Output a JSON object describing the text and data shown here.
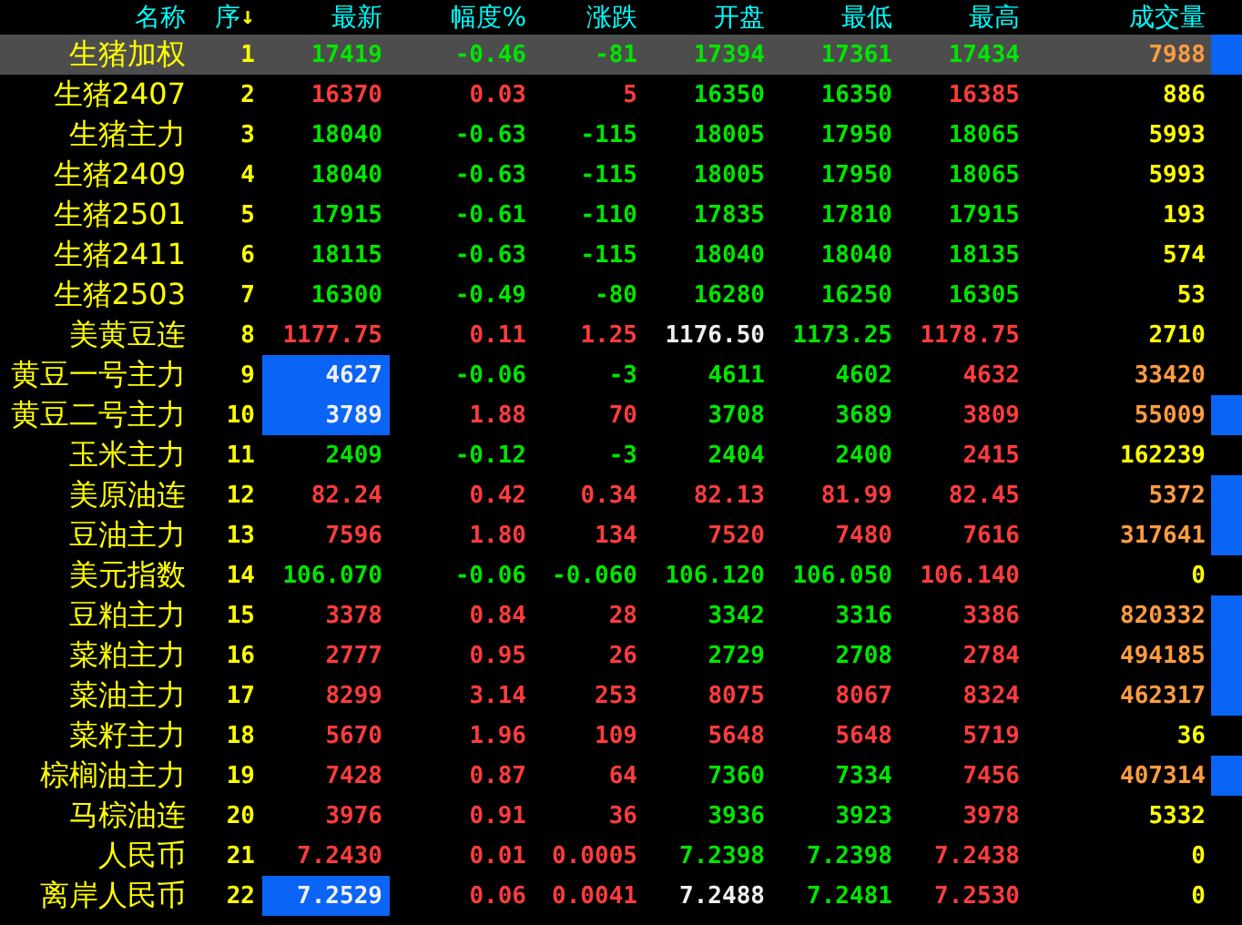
{
  "columns": [
    {
      "label": "名称"
    },
    {
      "label": "序",
      "sort_mark": "↓"
    },
    {
      "label": "最新"
    },
    {
      "label": "幅度%"
    },
    {
      "label": "涨跌"
    },
    {
      "label": "开盘"
    },
    {
      "label": "最低"
    },
    {
      "label": "最高"
    },
    {
      "label": "成交量"
    }
  ],
  "rows": [
    {
      "name": "生猪加权",
      "seq": "1",
      "selected": true,
      "flagged": true,
      "latest_highlighted": false,
      "cells": [
        {
          "text": "17419",
          "color": "#00e600"
        },
        {
          "text": "-0.46",
          "color": "#00e600"
        },
        {
          "text": "-81",
          "color": "#00e600"
        },
        {
          "text": "17394",
          "color": "#00e600"
        },
        {
          "text": "17361",
          "color": "#00e600"
        },
        {
          "text": "17434",
          "color": "#00e600"
        },
        {
          "text": "7988",
          "color": "#ff9c40"
        }
      ]
    },
    {
      "name": "生猪2407",
      "seq": "2",
      "selected": false,
      "flagged": false,
      "latest_highlighted": false,
      "cells": [
        {
          "text": "16370",
          "color": "#ff3c3c"
        },
        {
          "text": "0.03",
          "color": "#ff3c3c"
        },
        {
          "text": "5",
          "color": "#ff3c3c"
        },
        {
          "text": "16350",
          "color": "#00e600"
        },
        {
          "text": "16350",
          "color": "#00e600"
        },
        {
          "text": "16385",
          "color": "#ff3c3c"
        },
        {
          "text": "886",
          "color": "#ffff00"
        }
      ]
    },
    {
      "name": "生猪主力",
      "seq": "3",
      "selected": false,
      "flagged": false,
      "latest_highlighted": false,
      "cells": [
        {
          "text": "18040",
          "color": "#00e600"
        },
        {
          "text": "-0.63",
          "color": "#00e600"
        },
        {
          "text": "-115",
          "color": "#00e600"
        },
        {
          "text": "18005",
          "color": "#00e600"
        },
        {
          "text": "17950",
          "color": "#00e600"
        },
        {
          "text": "18065",
          "color": "#00e600"
        },
        {
          "text": "5993",
          "color": "#ffff00"
        }
      ]
    },
    {
      "name": "生猪2409",
      "seq": "4",
      "selected": false,
      "flagged": false,
      "latest_highlighted": false,
      "cells": [
        {
          "text": "18040",
          "color": "#00e600"
        },
        {
          "text": "-0.63",
          "color": "#00e600"
        },
        {
          "text": "-115",
          "color": "#00e600"
        },
        {
          "text": "18005",
          "color": "#00e600"
        },
        {
          "text": "17950",
          "color": "#00e600"
        },
        {
          "text": "18065",
          "color": "#00e600"
        },
        {
          "text": "5993",
          "color": "#ffff00"
        }
      ]
    },
    {
      "name": "生猪2501",
      "seq": "5",
      "selected": false,
      "flagged": false,
      "latest_highlighted": false,
      "cells": [
        {
          "text": "17915",
          "color": "#00e600"
        },
        {
          "text": "-0.61",
          "color": "#00e600"
        },
        {
          "text": "-110",
          "color": "#00e600"
        },
        {
          "text": "17835",
          "color": "#00e600"
        },
        {
          "text": "17810",
          "color": "#00e600"
        },
        {
          "text": "17915",
          "color": "#00e600"
        },
        {
          "text": "193",
          "color": "#ffff00"
        }
      ]
    },
    {
      "name": "生猪2411",
      "seq": "6",
      "selected": false,
      "flagged": false,
      "latest_highlighted": false,
      "cells": [
        {
          "text": "18115",
          "color": "#00e600"
        },
        {
          "text": "-0.63",
          "color": "#00e600"
        },
        {
          "text": "-115",
          "color": "#00e600"
        },
        {
          "text": "18040",
          "color": "#00e600"
        },
        {
          "text": "18040",
          "color": "#00e600"
        },
        {
          "text": "18135",
          "color": "#00e600"
        },
        {
          "text": "574",
          "color": "#ffff00"
        }
      ]
    },
    {
      "name": "生猪2503",
      "seq": "7",
      "selected": false,
      "flagged": false,
      "latest_highlighted": false,
      "cells": [
        {
          "text": "16300",
          "color": "#00e600"
        },
        {
          "text": "-0.49",
          "color": "#00e600"
        },
        {
          "text": "-80",
          "color": "#00e600"
        },
        {
          "text": "16280",
          "color": "#00e600"
        },
        {
          "text": "16250",
          "color": "#00e600"
        },
        {
          "text": "16305",
          "color": "#00e600"
        },
        {
          "text": "53",
          "color": "#ffff00"
        }
      ]
    },
    {
      "name": "美黄豆连",
      "seq": "8",
      "selected": false,
      "flagged": false,
      "latest_highlighted": false,
      "cells": [
        {
          "text": "1177.75",
          "color": "#ff3c3c"
        },
        {
          "text": "0.11",
          "color": "#ff3c3c"
        },
        {
          "text": "1.25",
          "color": "#ff3c3c"
        },
        {
          "text": "1176.50",
          "color": "#f0f0f0"
        },
        {
          "text": "1173.25",
          "color": "#00e600"
        },
        {
          "text": "1178.75",
          "color": "#ff3c3c"
        },
        {
          "text": "2710",
          "color": "#ffff00"
        }
      ]
    },
    {
      "name": "黄豆一号主力",
      "seq": "9",
      "selected": false,
      "flagged": false,
      "latest_highlighted": true,
      "cells": [
        {
          "text": "4627",
          "color": "#f0f0f0"
        },
        {
          "text": "-0.06",
          "color": "#00e600"
        },
        {
          "text": "-3",
          "color": "#00e600"
        },
        {
          "text": "4611",
          "color": "#00e600"
        },
        {
          "text": "4602",
          "color": "#00e600"
        },
        {
          "text": "4632",
          "color": "#ff3c3c"
        },
        {
          "text": "33420",
          "color": "#ff9c40"
        }
      ]
    },
    {
      "name": "黄豆二号主力",
      "seq": "10",
      "selected": false,
      "flagged": true,
      "latest_highlighted": true,
      "cells": [
        {
          "text": "3789",
          "color": "#f0f0f0"
        },
        {
          "text": "1.88",
          "color": "#ff3c3c"
        },
        {
          "text": "70",
          "color": "#ff3c3c"
        },
        {
          "text": "3708",
          "color": "#00e600"
        },
        {
          "text": "3689",
          "color": "#00e600"
        },
        {
          "text": "3809",
          "color": "#ff3c3c"
        },
        {
          "text": "55009",
          "color": "#ff9c40"
        }
      ]
    },
    {
      "name": "玉米主力",
      "seq": "11",
      "selected": false,
      "flagged": false,
      "latest_highlighted": false,
      "cells": [
        {
          "text": "2409",
          "color": "#00e600"
        },
        {
          "text": "-0.12",
          "color": "#00e600"
        },
        {
          "text": "-3",
          "color": "#00e600"
        },
        {
          "text": "2404",
          "color": "#00e600"
        },
        {
          "text": "2400",
          "color": "#00e600"
        },
        {
          "text": "2415",
          "color": "#ff3c3c"
        },
        {
          "text": "162239",
          "color": "#ffff00"
        }
      ]
    },
    {
      "name": "美原油连",
      "seq": "12",
      "selected": false,
      "flagged": true,
      "latest_highlighted": false,
      "cells": [
        {
          "text": "82.24",
          "color": "#ff3c3c"
        },
        {
          "text": "0.42",
          "color": "#ff3c3c"
        },
        {
          "text": "0.34",
          "color": "#ff3c3c"
        },
        {
          "text": "82.13",
          "color": "#ff3c3c"
        },
        {
          "text": "81.99",
          "color": "#ff3c3c"
        },
        {
          "text": "82.45",
          "color": "#ff3c3c"
        },
        {
          "text": "5372",
          "color": "#ff9c40"
        }
      ]
    },
    {
      "name": "豆油主力",
      "seq": "13",
      "selected": false,
      "flagged": true,
      "latest_highlighted": false,
      "cells": [
        {
          "text": "7596",
          "color": "#ff3c3c"
        },
        {
          "text": "1.80",
          "color": "#ff3c3c"
        },
        {
          "text": "134",
          "color": "#ff3c3c"
        },
        {
          "text": "7520",
          "color": "#ff3c3c"
        },
        {
          "text": "7480",
          "color": "#ff3c3c"
        },
        {
          "text": "7616",
          "color": "#ff3c3c"
        },
        {
          "text": "317641",
          "color": "#ff9c40"
        }
      ]
    },
    {
      "name": "美元指数",
      "seq": "14",
      "selected": false,
      "flagged": false,
      "latest_highlighted": false,
      "cells": [
        {
          "text": "106.070",
          "color": "#00e600"
        },
        {
          "text": "-0.06",
          "color": "#00e600"
        },
        {
          "text": "-0.060",
          "color": "#00e600"
        },
        {
          "text": "106.120",
          "color": "#00e600"
        },
        {
          "text": "106.050",
          "color": "#00e600"
        },
        {
          "text": "106.140",
          "color": "#ff3c3c"
        },
        {
          "text": "0",
          "color": "#ffff00"
        }
      ]
    },
    {
      "name": "豆粕主力",
      "seq": "15",
      "selected": false,
      "flagged": true,
      "latest_highlighted": false,
      "cells": [
        {
          "text": "3378",
          "color": "#ff3c3c"
        },
        {
          "text": "0.84",
          "color": "#ff3c3c"
        },
        {
          "text": "28",
          "color": "#ff3c3c"
        },
        {
          "text": "3342",
          "color": "#00e600"
        },
        {
          "text": "3316",
          "color": "#00e600"
        },
        {
          "text": "3386",
          "color": "#ff3c3c"
        },
        {
          "text": "820332",
          "color": "#ff9c40"
        }
      ]
    },
    {
      "name": "菜粕主力",
      "seq": "16",
      "selected": false,
      "flagged": true,
      "latest_highlighted": false,
      "cells": [
        {
          "text": "2777",
          "color": "#ff3c3c"
        },
        {
          "text": "0.95",
          "color": "#ff3c3c"
        },
        {
          "text": "26",
          "color": "#ff3c3c"
        },
        {
          "text": "2729",
          "color": "#00e600"
        },
        {
          "text": "2708",
          "color": "#00e600"
        },
        {
          "text": "2784",
          "color": "#ff3c3c"
        },
        {
          "text": "494185",
          "color": "#ff9c40"
        }
      ]
    },
    {
      "name": "菜油主力",
      "seq": "17",
      "selected": false,
      "flagged": true,
      "latest_highlighted": false,
      "cells": [
        {
          "text": "8299",
          "color": "#ff3c3c"
        },
        {
          "text": "3.14",
          "color": "#ff3c3c"
        },
        {
          "text": "253",
          "color": "#ff3c3c"
        },
        {
          "text": "8075",
          "color": "#ff3c3c"
        },
        {
          "text": "8067",
          "color": "#ff3c3c"
        },
        {
          "text": "8324",
          "color": "#ff3c3c"
        },
        {
          "text": "462317",
          "color": "#ff9c40"
        }
      ]
    },
    {
      "name": "菜籽主力",
      "seq": "18",
      "selected": false,
      "flagged": false,
      "latest_highlighted": false,
      "cells": [
        {
          "text": "5670",
          "color": "#ff3c3c"
        },
        {
          "text": "1.96",
          "color": "#ff3c3c"
        },
        {
          "text": "109",
          "color": "#ff3c3c"
        },
        {
          "text": "5648",
          "color": "#ff3c3c"
        },
        {
          "text": "5648",
          "color": "#ff3c3c"
        },
        {
          "text": "5719",
          "color": "#ff3c3c"
        },
        {
          "text": "36",
          "color": "#ffff00"
        }
      ]
    },
    {
      "name": "棕榈油主力",
      "seq": "19",
      "selected": false,
      "flagged": true,
      "latest_highlighted": false,
      "cells": [
        {
          "text": "7428",
          "color": "#ff3c3c"
        },
        {
          "text": "0.87",
          "color": "#ff3c3c"
        },
        {
          "text": "64",
          "color": "#ff3c3c"
        },
        {
          "text": "7360",
          "color": "#00e600"
        },
        {
          "text": "7334",
          "color": "#00e600"
        },
        {
          "text": "7456",
          "color": "#ff3c3c"
        },
        {
          "text": "407314",
          "color": "#ff9c40"
        }
      ]
    },
    {
      "name": "马棕油连",
      "seq": "20",
      "selected": false,
      "flagged": false,
      "latest_highlighted": false,
      "cells": [
        {
          "text": "3976",
          "color": "#ff3c3c"
        },
        {
          "text": "0.91",
          "color": "#ff3c3c"
        },
        {
          "text": "36",
          "color": "#ff3c3c"
        },
        {
          "text": "3936",
          "color": "#00e600"
        },
        {
          "text": "3923",
          "color": "#00e600"
        },
        {
          "text": "3978",
          "color": "#ff3c3c"
        },
        {
          "text": "5332",
          "color": "#ffff00"
        }
      ]
    },
    {
      "name": "人民币",
      "seq": "21",
      "selected": false,
      "flagged": false,
      "latest_highlighted": false,
      "cells": [
        {
          "text": "7.2430",
          "color": "#ff3c3c"
        },
        {
          "text": "0.01",
          "color": "#ff3c3c"
        },
        {
          "text": "0.0005",
          "color": "#ff3c3c"
        },
        {
          "text": "7.2398",
          "color": "#00e600"
        },
        {
          "text": "7.2398",
          "color": "#00e600"
        },
        {
          "text": "7.2438",
          "color": "#ff3c3c"
        },
        {
          "text": "0",
          "color": "#ffff00"
        }
      ]
    },
    {
      "name": "离岸人民币",
      "seq": "22",
      "selected": false,
      "flagged": false,
      "latest_highlighted": true,
      "cells": [
        {
          "text": "7.2529",
          "color": "#f0f0f0"
        },
        {
          "text": "0.06",
          "color": "#ff3c3c"
        },
        {
          "text": "0.0041",
          "color": "#ff3c3c"
        },
        {
          "text": "7.2488",
          "color": "#f0f0f0"
        },
        {
          "text": "7.2481",
          "color": "#00e600"
        },
        {
          "text": "7.2530",
          "color": "#ff3c3c"
        },
        {
          "text": "0",
          "color": "#ffff00"
        }
      ]
    }
  ]
}
